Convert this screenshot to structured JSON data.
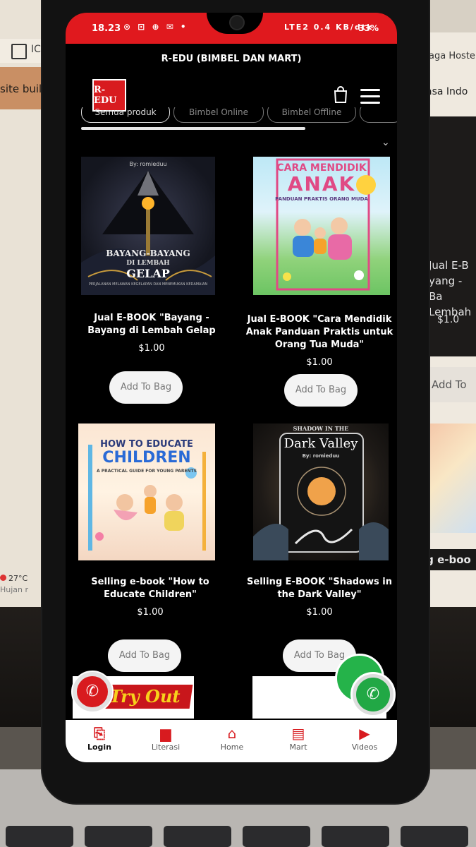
{
  "status_bar": {
    "time": "18.23",
    "notification_icons": "⊙ ⊡ ⊕ ✉ •",
    "network": "LTE2 0.4 KB/dtk",
    "battery": "33%"
  },
  "app": {
    "title": "R-EDU (BIMBEL DAN MART)",
    "logo_text": "R-EDU"
  },
  "filters": {
    "chips": [
      "Semua produk",
      "Bimbel Online",
      "Bimbel Offline",
      ""
    ]
  },
  "products": [
    {
      "name": "Jual E-BOOK \"Bayang - Bayang di Lembah Gelap",
      "price": "$1.00",
      "button": "Add To Bag",
      "cover_author": "By: romieduu",
      "cover_title_1": "BAYANG-BAYANG",
      "cover_title_2": "DI LEMBAH",
      "cover_title_3": "GELAP",
      "cover_subtitle": "PERJALANAN MELAWAN KEGELAPAN DAN MENEMUKAN KEDAMAIAN"
    },
    {
      "name": "Jual E-BOOK \"Cara Mendidik Anak Panduan Praktis untuk Orang Tua Muda\"",
      "price": "$1.00",
      "button": "Add To Bag",
      "cover_title_1": "CARA MENDIDIK",
      "cover_title_2": "ANAK",
      "cover_subtitle": "PANDUAN PRAKTIS ORANG MUDA"
    },
    {
      "name": "Selling e-book \"How to Educate Children\"",
      "price": "$1.00",
      "button": "Add To Bag",
      "cover_title_1": "HOW TO EDUCATE",
      "cover_title_2": "CHILDREN",
      "cover_subtitle": "A PRACTICAL GUIDE FOR YOUNG PARENTS"
    },
    {
      "name": "Selling E-BOOK \"Shadows in the Dark Valley\"",
      "price": "$1.00",
      "button": "Add To Bag",
      "cover_title_1": "SHADOW IN THE",
      "cover_title_2": "Dark Valley",
      "cover_author": "By: romieduu"
    }
  ],
  "promo": {
    "tryout": "Try Out"
  },
  "bottom_nav": [
    {
      "label": "Login",
      "icon": "login-icon"
    },
    {
      "label": "Literasi",
      "icon": "book-icon"
    },
    {
      "label": "Home",
      "icon": "home-icon"
    },
    {
      "label": "Mart",
      "icon": "store-icon"
    },
    {
      "label": "Videos",
      "icon": "play-icon"
    }
  ],
  "background": {
    "left_text": "site buil",
    "left_icon_text": "IC",
    "weather_temp": "27°C",
    "weather_desc": "Hujan r",
    "right_text_1": "aga Hoste",
    "right_text_2": "asa Indo",
    "right_product_name": "Jual E-B yang - Ba Lembah",
    "right_price": "$1.0",
    "right_button": "Add To",
    "right_sell": "lling e-boo"
  },
  "colors": {
    "accent": "#e0191e",
    "screen_bg": "#000000",
    "nav_bg": "#ffffff",
    "button_bg": "#f4f4f4"
  }
}
